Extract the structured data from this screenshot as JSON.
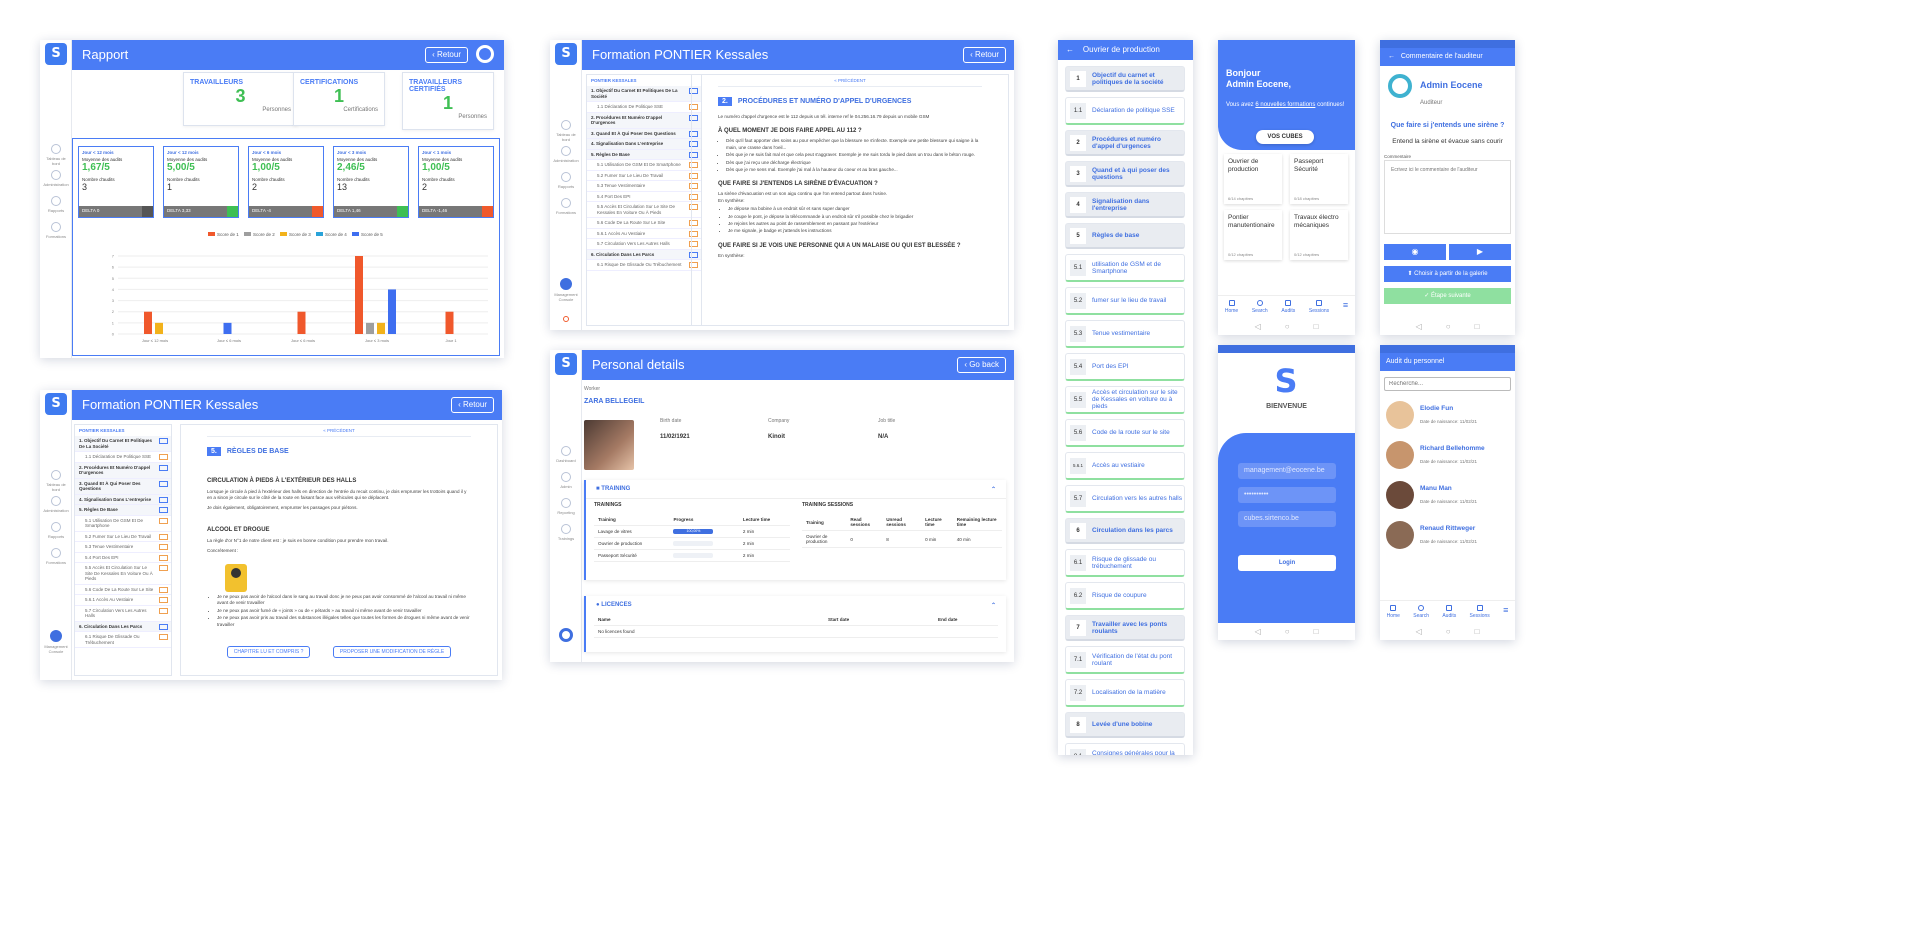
{
  "rapport": {
    "title": "Rapport",
    "back": "Retour",
    "stats": [
      {
        "label": "Travailleurs",
        "value": "3",
        "sub": "Personnes"
      },
      {
        "label": "Certifications",
        "value": "1",
        "sub": "Certifications"
      },
      {
        "label": "Travailleurs certifiés",
        "value": "1",
        "sub": "Personnes"
      }
    ],
    "scores": [
      {
        "period": "Jour < 12 mois",
        "label": "Moyenne des audits",
        "value": "1,67/5",
        "count_label": "Nombre d'audits",
        "count": "3",
        "delta": "DELTA 0"
      },
      {
        "period": "Jour < 12 mois",
        "label": "Moyenne des audits",
        "value": "5,00/5",
        "count_label": "Nombre d'audits",
        "count": "1",
        "delta": "DELTA 3,33"
      },
      {
        "period": "Jour < 6 mois",
        "label": "Moyenne des audits",
        "value": "1,00/5",
        "count_label": "Nombre d'audits",
        "count": "2",
        "delta": "DELTA -4"
      },
      {
        "period": "Jour < 3 mois",
        "label": "Moyenne des audits",
        "value": "2,46/5",
        "count_label": "Nombre d'audits",
        "count": "13",
        "delta": "DELTA 1,46"
      },
      {
        "period": "Jour < 1 mois",
        "label": "Moyenne des audits",
        "value": "1,00/5",
        "count_label": "Nombre d'audits",
        "count": "2",
        "delta": "DELTA -1,46"
      }
    ],
    "nav": [
      "Tableau de bord",
      "Administration",
      "Rapports",
      "Formations"
    ]
  },
  "chart_data": {
    "type": "bar",
    "categories": [
      "Jour ≤ 12 mois",
      "Jour ≤ 6 mois",
      "Jour ≤ 6 mois",
      "Jour ≤ 3 mois",
      "Jour 1"
    ],
    "series": [
      {
        "name": "Score de 1",
        "color": "#f0582c",
        "values": [
          2,
          0,
          2,
          7,
          2
        ]
      },
      {
        "name": "Score de 2",
        "color": "#9e9e9e",
        "values": [
          0,
          0,
          0,
          1,
          0
        ]
      },
      {
        "name": "Score de 3",
        "color": "#f2b21b",
        "values": [
          1,
          0,
          0,
          1,
          0
        ]
      },
      {
        "name": "Score de 4",
        "color": "#29a3d9",
        "values": [
          0,
          0,
          0,
          0,
          0
        ]
      },
      {
        "name": "Score de 5",
        "color": "#3e6ef0",
        "values": [
          0,
          1,
          0,
          4,
          0
        ]
      }
    ],
    "ylim": [
      0,
      7
    ],
    "yticks": [
      "0",
      "1",
      "2",
      "3",
      "4",
      "5",
      "6",
      "7"
    ],
    "legend": "top"
  },
  "formation1": {
    "title": "Formation PONTIER Kessales",
    "back": "Retour",
    "prev": "« PRÉCÉDENT",
    "tree_header": "PONTIER KESSALES",
    "tree": [
      "1. Objectif Du Carnet Et Politiques De La Société",
      "1.1 Déclaration De Politique SSE",
      "2. Procédures Et Numéro D'appel D'urgences",
      "3. Quand Et À Qui Poser Des Questions",
      "4. Signalisation Dans L'entreprise",
      "5. Règles De Base",
      "5.1 Utilisation De GSM Et De Smartphone",
      "5.2 Fumer Sur Le Lieu De Travail",
      "5.3 Tenue Vestimentaire",
      "5.4 Port Des EPI",
      "5.5 Accès Et Circulation Sur Le Site De Kessales En Voiture Ou À Pieds",
      "5.6 Code De La Route Sur Le Site",
      "5.6.1 Accès Au Vestiaire",
      "5.7 Circulation Vers Les Autres Halls",
      "6. Circulation Dans Les Parcs",
      "6.1 Risque De Glissade Ou Trébuchement"
    ],
    "num": "2.",
    "heading": "PROCÉDURES ET NUMÉRO D'APPEL D'URGENCES",
    "intro": "Le numéro d'appel d'urgence est le 112 depuis un tél. interne ref le 04.256.16.79 depuis un mobile GSM",
    "q1": "À QUEL MOMENT JE DOIS FAIRE APPEL AU 112 ?",
    "q1_items": [
      "Dès qu'il faut apporter des soins au pour empêcher que la blessure ne s'infecte. Exemple une petite blessure qui saigne à la main, une crasse dans l'oeil...",
      "Dès que je ne suis fait mal et que cela peut s'aggraver. Exemple je me suis tordu le pied dans un trou dans le béton rouge.",
      "Dès que j'ai reçu une décharge électrique",
      "Dès que je me sens mal. Exemple j'ai mal à la hauteur du coeur et au bras gauche..."
    ],
    "q2": "QUE FAIRE SI J'ENTENDS LA SIRÈNE D'ÉVACUATION ?",
    "q2_text": "La sirène d'évacuation est un son aigu continu que l'on entend partout dans l'usine.",
    "q2_sub": "En synthèse:",
    "q2_items": [
      "Je dépose ma bobine à un endroit sûr et sans super danger",
      "Je coupe le pont, je dépose la télécommande à un endroit sûr s'il possible chez le brigadier",
      "Je rejoins les autres au point de rassemblement en passant par l'extérieur",
      "Je me signale, je badge et j'attends les instructions"
    ],
    "q3": "QUE FAIRE SI JE VOIS UNE PERSONNE QUI A UN MALAISE OU QUI EST BLESSÉE ?",
    "q3_text": "En synthèse:",
    "nav": [
      "Tableau de bord",
      "Administration",
      "Rapports",
      "Formations",
      "Management Console"
    ]
  },
  "formation2": {
    "title": "Formation PONTIER Kessales",
    "back": "Retour",
    "prev": "« PRÉCÉDENT",
    "num": "5.",
    "heading": "RÈGLES DE BASE",
    "s1": "CIRCULATION À PIEDS À L'EXTÉRIEUR DES HALLS",
    "s1_text": "Lorsque je circule à pied à l'extérieur des halls en direction de l'entrée du recuit continu, je dois emprunter les trottoirs quand il y en a sinon je circule sur le côté de la route en faisant face aux véhicules qui se déplacent.",
    "s1_text2": "Je dois également, obligatoirement, emprunter les passages pour piétons.",
    "s2": "ALCOOL ET DROGUE",
    "s2_text": "La règle d'or N°1 de notre client est : je suis en bonne condition pour prendre mon travail.",
    "s2_sub": "Concrètement :",
    "s2_items": [
      "Je ne peux pas avoir de l'alcool dans le sang au travail donc je ne peux pas avoir consommé de l'alcool au travail ni même avant de venir travailler",
      "Je ne peux pas avoir fumé de « joints » ou de « pétards » au travail ni même avant de venir travailler",
      "Je ne peux pas avoir pris au travail des substances illégales telles que toutes les formes de drogues ni même avant de venir travailler"
    ],
    "btn1": "CHAPITRE LU ET COMPRIS ?",
    "btn2": "PROPOSER UNE MODIFICATION DE RÈGLE"
  },
  "personal": {
    "title": "Personal details",
    "back": "Go back",
    "worker_label": "Worker",
    "name_first": "ZARA",
    "name_last": "BELLEGEIL",
    "fields": [
      {
        "label": "Birth date",
        "value": "11/02/1921"
      },
      {
        "label": "Company",
        "value": "Kinoit"
      },
      {
        "label": "Job title",
        "value": "N/A"
      }
    ],
    "training_title": "TRAINING",
    "trainings_label": "TRAININGS",
    "trainings_cols": [
      "Training",
      "Progress",
      "Lecture time"
    ],
    "trainings": [
      {
        "name": "Lavage de vitres",
        "progress": "100,00%",
        "time": "2 min"
      },
      {
        "name": "Ouvrier de production",
        "progress": "",
        "time": "2 min"
      },
      {
        "name": "Passeport Sécurité",
        "progress": "",
        "time": "2 min"
      }
    ],
    "sessions_label": "TRAINING SESSIONS",
    "sessions_cols": [
      "Training",
      "Read sessions",
      "Unread sessions",
      "Lecture time",
      "Remaining lecture time"
    ],
    "sessions": [
      {
        "name": "Ouvrier de production",
        "read": "0",
        "unread": "8",
        "time": "0 min",
        "remaining": "40 min"
      }
    ],
    "licences_title": "LICENCES",
    "licences_cols": [
      "Name",
      "Start date",
      "End date"
    ],
    "licences_empty": "No licences found",
    "nav": [
      "Dashboard",
      "Admin",
      "Reporting",
      "Trainings"
    ]
  },
  "ouvrier": {
    "title": "Ouvrier de production",
    "items": [
      {
        "n": "1",
        "label": "Objectif du carnet et politiques de la société",
        "chapter": true
      },
      {
        "n": "1.1",
        "label": "Déclaration de politique SSE",
        "chapter": false
      },
      {
        "n": "2",
        "label": "Procédures et numéro d'appel d'urgences",
        "chapter": true
      },
      {
        "n": "3",
        "label": "Quand et à qui poser des questions",
        "chapter": true
      },
      {
        "n": "4",
        "label": "Signalisation dans l'entreprise",
        "chapter": true
      },
      {
        "n": "5",
        "label": "Règles de base",
        "chapter": true
      },
      {
        "n": "5.1",
        "label": "utilisation de GSM et de Smartphone",
        "chapter": false
      },
      {
        "n": "5.2",
        "label": "fumer sur le lieu de travail",
        "chapter": false
      },
      {
        "n": "5.3",
        "label": "Tenue vestimentaire",
        "chapter": false
      },
      {
        "n": "5.4",
        "label": "Port des EPI",
        "chapter": false
      },
      {
        "n": "5.5",
        "label": "Accès et circulation sur le site de Kessales en voiture ou à pieds",
        "chapter": false
      },
      {
        "n": "5.6",
        "label": "Code de la route sur le site",
        "chapter": false
      },
      {
        "n": "5.6.1",
        "label": "Accès au vestiaire",
        "chapter": false
      },
      {
        "n": "5.7",
        "label": "Circulation vers les autres halls",
        "chapter": false
      },
      {
        "n": "6",
        "label": "Circulation dans les parcs",
        "chapter": true
      },
      {
        "n": "6.1",
        "label": "Risque de glissade ou trébuchement",
        "chapter": false
      },
      {
        "n": "6.2",
        "label": "Risque de coupure",
        "chapter": false
      },
      {
        "n": "7",
        "label": "Travailler avec les ponts roulants",
        "chapter": true
      },
      {
        "n": "7.1",
        "label": "Vérification de l'état du pont roulant",
        "chapter": false
      },
      {
        "n": "7.2",
        "label": "Localisation de la matière",
        "chapter": false
      },
      {
        "n": "8",
        "label": "Levée d'une bobine",
        "chapter": true
      },
      {
        "n": "8.1",
        "label": "Consignes générales pour la levée",
        "chapter": false
      }
    ]
  },
  "home": {
    "greeting": "Bonjour",
    "name": "Admin Eocene,",
    "msg_pre": "Vous avez ",
    "msg_link": "6 nouvelles formations",
    "msg_post": " continues!",
    "cubes_btn": "VOS CUBES",
    "tiles": [
      {
        "title": "Ouvrier de production",
        "sub": "6/14 chapitres"
      },
      {
        "title": "Passeport Sécurité",
        "sub": "0/18 chapitres"
      },
      {
        "title": "Pontier manutentionaire",
        "sub": "0/12 chapitres"
      },
      {
        "title": "Travaux électro mécaniques",
        "sub": "0/12 chapitres"
      }
    ],
    "nav": [
      "Home",
      "Search",
      "Audits",
      "Sessions"
    ]
  },
  "comment": {
    "title": "Commentaire de l'auditeur",
    "user": "Admin Eocene",
    "role": "Auditeur",
    "question": "Que faire si j'entends une sirène ?",
    "answer": "Entend la sirène et évacue sans courir",
    "comment_label": "Commentaire",
    "placeholder": "Ecrivez ici le commentaire de l'auditeur",
    "gallery_btn": "Choisir à partir de la galerie",
    "next_btn": "Étape suivante"
  },
  "login": {
    "welcome": "BIENVENUE",
    "email": "management@eocene.be",
    "password": "••••••••••",
    "server": "cubes.sirtenco.be",
    "login_btn": "Login"
  },
  "audit": {
    "title": "Audit du personnel",
    "search_placeholder": "Recherche...",
    "people": [
      {
        "name": "Elodie Fun",
        "sub": "Date de naissance: 11/02/21"
      },
      {
        "name": "Richard Bellehomme",
        "sub": "Date de naissance: 11/02/21"
      },
      {
        "name": "Manu Man",
        "sub": "Date de naissance: 11/02/21"
      },
      {
        "name": "Renaud Rittweger",
        "sub": "Date de naissance: 11/02/21"
      }
    ],
    "nav": [
      "Home",
      "Search",
      "Audits",
      "Sessions"
    ]
  }
}
